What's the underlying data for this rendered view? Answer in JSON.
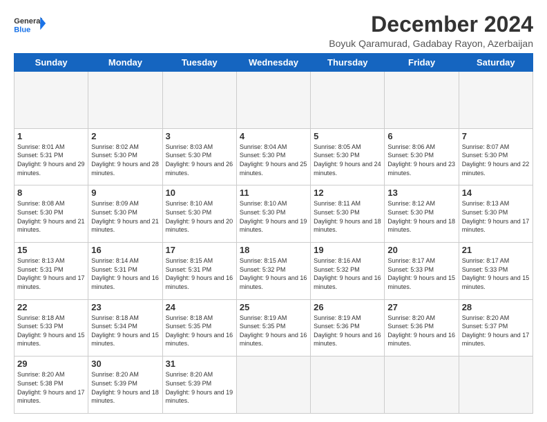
{
  "header": {
    "logo_line1": "General",
    "logo_line2": "Blue",
    "main_title": "December 2024",
    "subtitle": "Boyuk Qaramurad, Gadabay Rayon, Azerbaijan"
  },
  "calendar": {
    "days_of_week": [
      "Sunday",
      "Monday",
      "Tuesday",
      "Wednesday",
      "Thursday",
      "Friday",
      "Saturday"
    ],
    "weeks": [
      [
        {
          "day": "",
          "empty": true
        },
        {
          "day": "",
          "empty": true
        },
        {
          "day": "",
          "empty": true
        },
        {
          "day": "",
          "empty": true
        },
        {
          "day": "",
          "empty": true
        },
        {
          "day": "",
          "empty": true
        },
        {
          "day": "",
          "empty": true
        }
      ],
      [
        {
          "day": "1",
          "sunrise": "Sunrise: 8:01 AM",
          "sunset": "Sunset: 5:31 PM",
          "daylight": "Daylight: 9 hours and 29 minutes."
        },
        {
          "day": "2",
          "sunrise": "Sunrise: 8:02 AM",
          "sunset": "Sunset: 5:30 PM",
          "daylight": "Daylight: 9 hours and 28 minutes."
        },
        {
          "day": "3",
          "sunrise": "Sunrise: 8:03 AM",
          "sunset": "Sunset: 5:30 PM",
          "daylight": "Daylight: 9 hours and 26 minutes."
        },
        {
          "day": "4",
          "sunrise": "Sunrise: 8:04 AM",
          "sunset": "Sunset: 5:30 PM",
          "daylight": "Daylight: 9 hours and 25 minutes."
        },
        {
          "day": "5",
          "sunrise": "Sunrise: 8:05 AM",
          "sunset": "Sunset: 5:30 PM",
          "daylight": "Daylight: 9 hours and 24 minutes."
        },
        {
          "day": "6",
          "sunrise": "Sunrise: 8:06 AM",
          "sunset": "Sunset: 5:30 PM",
          "daylight": "Daylight: 9 hours and 23 minutes."
        },
        {
          "day": "7",
          "sunrise": "Sunrise: 8:07 AM",
          "sunset": "Sunset: 5:30 PM",
          "daylight": "Daylight: 9 hours and 22 minutes."
        }
      ],
      [
        {
          "day": "8",
          "sunrise": "Sunrise: 8:08 AM",
          "sunset": "Sunset: 5:30 PM",
          "daylight": "Daylight: 9 hours and 21 minutes."
        },
        {
          "day": "9",
          "sunrise": "Sunrise: 8:09 AM",
          "sunset": "Sunset: 5:30 PM",
          "daylight": "Daylight: 9 hours and 21 minutes."
        },
        {
          "day": "10",
          "sunrise": "Sunrise: 8:10 AM",
          "sunset": "Sunset: 5:30 PM",
          "daylight": "Daylight: 9 hours and 20 minutes."
        },
        {
          "day": "11",
          "sunrise": "Sunrise: 8:10 AM",
          "sunset": "Sunset: 5:30 PM",
          "daylight": "Daylight: 9 hours and 19 minutes."
        },
        {
          "day": "12",
          "sunrise": "Sunrise: 8:11 AM",
          "sunset": "Sunset: 5:30 PM",
          "daylight": "Daylight: 9 hours and 18 minutes."
        },
        {
          "day": "13",
          "sunrise": "Sunrise: 8:12 AM",
          "sunset": "Sunset: 5:30 PM",
          "daylight": "Daylight: 9 hours and 18 minutes."
        },
        {
          "day": "14",
          "sunrise": "Sunrise: 8:13 AM",
          "sunset": "Sunset: 5:30 PM",
          "daylight": "Daylight: 9 hours and 17 minutes."
        }
      ],
      [
        {
          "day": "15",
          "sunrise": "Sunrise: 8:13 AM",
          "sunset": "Sunset: 5:31 PM",
          "daylight": "Daylight: 9 hours and 17 minutes."
        },
        {
          "day": "16",
          "sunrise": "Sunrise: 8:14 AM",
          "sunset": "Sunset: 5:31 PM",
          "daylight": "Daylight: 9 hours and 16 minutes."
        },
        {
          "day": "17",
          "sunrise": "Sunrise: 8:15 AM",
          "sunset": "Sunset: 5:31 PM",
          "daylight": "Daylight: 9 hours and 16 minutes."
        },
        {
          "day": "18",
          "sunrise": "Sunrise: 8:15 AM",
          "sunset": "Sunset: 5:32 PM",
          "daylight": "Daylight: 9 hours and 16 minutes."
        },
        {
          "day": "19",
          "sunrise": "Sunrise: 8:16 AM",
          "sunset": "Sunset: 5:32 PM",
          "daylight": "Daylight: 9 hours and 16 minutes."
        },
        {
          "day": "20",
          "sunrise": "Sunrise: 8:17 AM",
          "sunset": "Sunset: 5:33 PM",
          "daylight": "Daylight: 9 hours and 15 minutes."
        },
        {
          "day": "21",
          "sunrise": "Sunrise: 8:17 AM",
          "sunset": "Sunset: 5:33 PM",
          "daylight": "Daylight: 9 hours and 15 minutes."
        }
      ],
      [
        {
          "day": "22",
          "sunrise": "Sunrise: 8:18 AM",
          "sunset": "Sunset: 5:33 PM",
          "daylight": "Daylight: 9 hours and 15 minutes."
        },
        {
          "day": "23",
          "sunrise": "Sunrise: 8:18 AM",
          "sunset": "Sunset: 5:34 PM",
          "daylight": "Daylight: 9 hours and 15 minutes."
        },
        {
          "day": "24",
          "sunrise": "Sunrise: 8:18 AM",
          "sunset": "Sunset: 5:35 PM",
          "daylight": "Daylight: 9 hours and 16 minutes."
        },
        {
          "day": "25",
          "sunrise": "Sunrise: 8:19 AM",
          "sunset": "Sunset: 5:35 PM",
          "daylight": "Daylight: 9 hours and 16 minutes."
        },
        {
          "day": "26",
          "sunrise": "Sunrise: 8:19 AM",
          "sunset": "Sunset: 5:36 PM",
          "daylight": "Daylight: 9 hours and 16 minutes."
        },
        {
          "day": "27",
          "sunrise": "Sunrise: 8:20 AM",
          "sunset": "Sunset: 5:36 PM",
          "daylight": "Daylight: 9 hours and 16 minutes."
        },
        {
          "day": "28",
          "sunrise": "Sunrise: 8:20 AM",
          "sunset": "Sunset: 5:37 PM",
          "daylight": "Daylight: 9 hours and 17 minutes."
        }
      ],
      [
        {
          "day": "29",
          "sunrise": "Sunrise: 8:20 AM",
          "sunset": "Sunset: 5:38 PM",
          "daylight": "Daylight: 9 hours and 17 minutes."
        },
        {
          "day": "30",
          "sunrise": "Sunrise: 8:20 AM",
          "sunset": "Sunset: 5:39 PM",
          "daylight": "Daylight: 9 hours and 18 minutes."
        },
        {
          "day": "31",
          "sunrise": "Sunrise: 8:20 AM",
          "sunset": "Sunset: 5:39 PM",
          "daylight": "Daylight: 9 hours and 19 minutes."
        },
        {
          "day": "",
          "empty": true
        },
        {
          "day": "",
          "empty": true
        },
        {
          "day": "",
          "empty": true
        },
        {
          "day": "",
          "empty": true
        }
      ]
    ]
  }
}
